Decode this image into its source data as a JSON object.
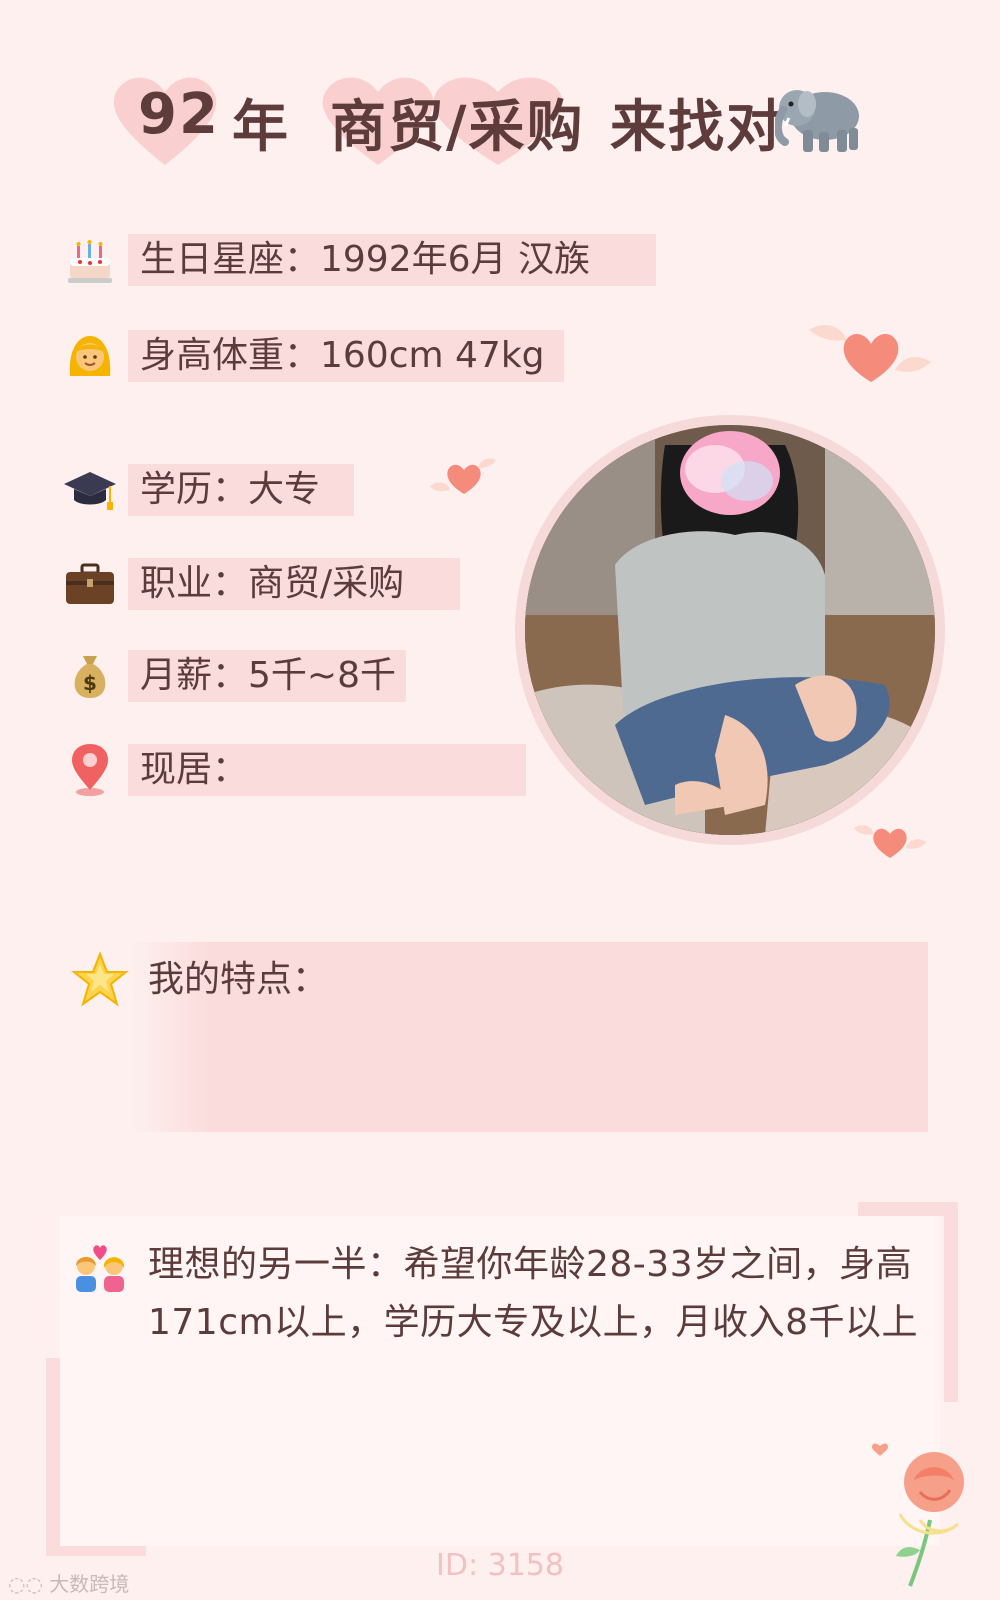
{
  "header": {
    "year": "92",
    "year_suffix": "年",
    "occupation": "商贸/采购",
    "tagline": "来找对"
  },
  "info": [
    {
      "icon": "cake-icon",
      "text": "生日星座：1992年6月 汉族"
    },
    {
      "icon": "woman-icon",
      "text": "身高体重：160cm 47kg"
    },
    {
      "icon": "graduation-cap-icon",
      "text": "学历：大专"
    },
    {
      "icon": "briefcase-icon",
      "text": "职业：商贸/采购"
    },
    {
      "icon": "money-bag-icon",
      "text": "月薪：5千~8千"
    },
    {
      "icon": "location-pin-icon",
      "text": "现居："
    }
  ],
  "features": {
    "label": "我的特点："
  },
  "ideal": {
    "line1": "理想的另一半：希望你年龄28-33岁之间，身高",
    "line2": "171cm以上，学历大专及以上，月收入8千以上"
  },
  "footer": {
    "id": "ID: 3158"
  },
  "watermark": "大数跨境",
  "colors": {
    "accent_pink": "#fbdcdc",
    "text": "#5c3b3b",
    "heart": "#f58b7a"
  }
}
